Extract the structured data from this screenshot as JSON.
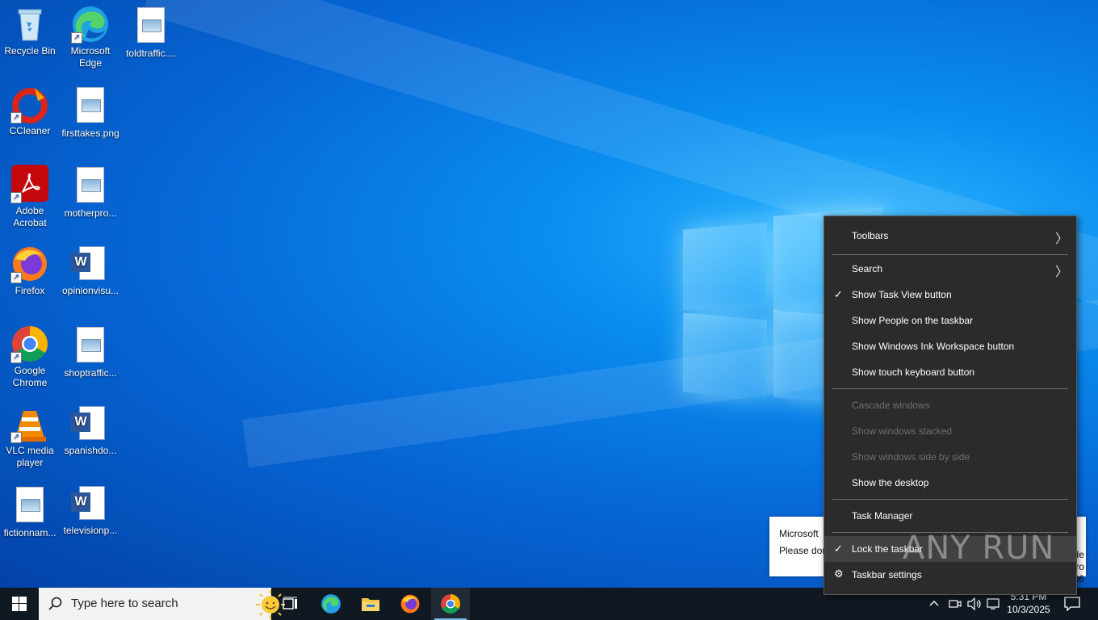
{
  "desktop": {
    "icons": [
      {
        "label": "Recycle Bin",
        "icon": "recycle-bin-icon"
      },
      {
        "label": "Microsoft Edge",
        "icon": "edge-icon"
      },
      {
        "label": "toldtraffic....",
        "icon": "image-file-icon"
      },
      {
        "label": "CCleaner",
        "icon": "ccleaner-icon"
      },
      {
        "label": "firsttakes.png",
        "icon": "image-file-icon"
      },
      {
        "label": "Adobe Acrobat",
        "icon": "acrobat-icon"
      },
      {
        "label": "motherpro...",
        "icon": "image-file-icon"
      },
      {
        "label": "Firefox",
        "icon": "firefox-icon"
      },
      {
        "label": "opinionvisu...",
        "icon": "word-doc-icon"
      },
      {
        "label": "Google Chrome",
        "icon": "chrome-icon"
      },
      {
        "label": "shoptraffic...",
        "icon": "image-file-icon"
      },
      {
        "label": "VLC media player",
        "icon": "vlc-icon"
      },
      {
        "label": "spanishdo...",
        "icon": "word-doc-icon"
      },
      {
        "label": "fictionnam...",
        "icon": "image-file-icon"
      },
      {
        "label": "televisionp...",
        "icon": "word-doc-icon"
      }
    ]
  },
  "toast": {
    "line1": "Microsoft",
    "line2": "Please dor",
    "side1": "de",
    "side2": "ro",
    "side3": "1406"
  },
  "context_menu": {
    "items": [
      {
        "label": "Toolbars",
        "submenu": true,
        "checked": false,
        "disabled": false
      },
      {
        "label": "Search",
        "submenu": true,
        "checked": false,
        "disabled": false
      },
      {
        "label": "Show Task View button",
        "checked": true,
        "disabled": false
      },
      {
        "label": "Show People on the taskbar",
        "checked": false,
        "disabled": false
      },
      {
        "label": "Show Windows Ink Workspace button",
        "checked": false,
        "disabled": false
      },
      {
        "label": "Show touch keyboard button",
        "checked": false,
        "disabled": false
      },
      {
        "label": "Cascade windows",
        "checked": false,
        "disabled": true
      },
      {
        "label": "Show windows stacked",
        "checked": false,
        "disabled": true
      },
      {
        "label": "Show windows side by side",
        "checked": false,
        "disabled": true
      },
      {
        "label": "Show the desktop",
        "checked": false,
        "disabled": false
      },
      {
        "label": "Task Manager",
        "checked": false,
        "disabled": false
      },
      {
        "label": "Lock the taskbar",
        "checked": true,
        "disabled": false
      },
      {
        "label": "Taskbar settings",
        "icon": "gear-icon",
        "disabled": false
      }
    ]
  },
  "taskbar": {
    "search_placeholder": "Type here to search",
    "clock_time": "5:31 PM",
    "clock_date": "10/3/2025",
    "pinned": [
      "task-view-icon",
      "edge-icon",
      "file-explorer-icon",
      "firefox-icon",
      "chrome-icon"
    ]
  },
  "watermark": "ANY RUN",
  "colors": {
    "taskbar_bg": "#101822",
    "menu_bg": "#2b2b2b",
    "chrome_active_underline": "#76b9ed"
  }
}
